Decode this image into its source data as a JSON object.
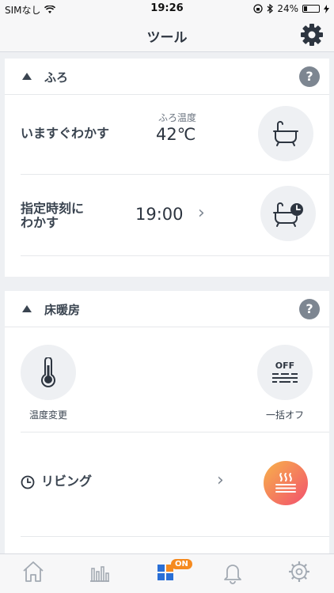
{
  "status_bar": {
    "carrier": "SIMなし",
    "time": "19:26",
    "battery": "24%",
    "battery_level": 0.24
  },
  "nav": {
    "title": "ツール"
  },
  "bath_card": {
    "title": "ふろ",
    "help": "?",
    "now_label": "いますぐわかす",
    "temp_caption": "ふろ温度",
    "temp_value": "42℃",
    "timer_label_line1": "指定時刻に",
    "timer_label_line2": "わかす",
    "timer_value": "19:00",
    "chevron": "›"
  },
  "floor_card": {
    "title": "床暖房",
    "help": "?",
    "temp_change_label": "温度変更",
    "all_off_label": "一括オフ",
    "off_icon_text": "OFF",
    "room_label": "リビング",
    "chevron": "›"
  },
  "tab_bar": {
    "items": [
      "home-icon",
      "chart-icon",
      "tools-icon",
      "bell-icon",
      "gear-icon"
    ],
    "badge": "ON",
    "active_color": "#2a6fd6",
    "badge_color": "#f58a1f"
  },
  "colors": {
    "heater_on_start": "#f7b24a",
    "heater_on_end": "#f2506e"
  }
}
